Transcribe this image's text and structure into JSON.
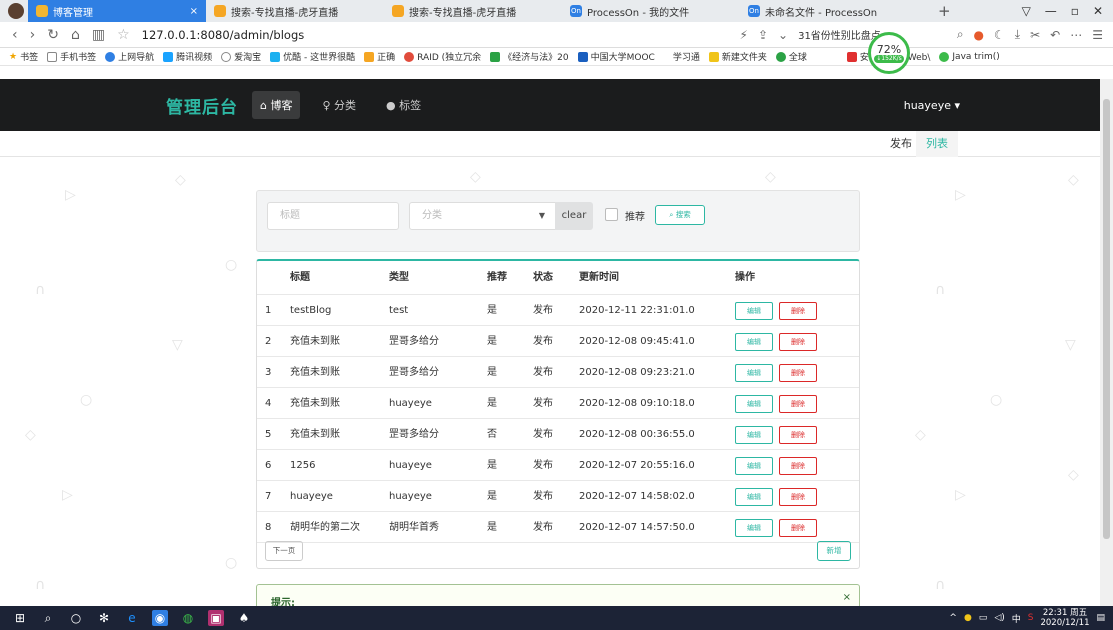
{
  "browser": {
    "tabs": [
      {
        "label": "博客管理",
        "active": true
      },
      {
        "label": "搜索-专找直播-虎牙直播"
      },
      {
        "label": "搜索-专找直播-虎牙直播"
      },
      {
        "label": "ProcessOn - 我的文件"
      },
      {
        "label": "未命名文件 - ProcessOn"
      }
    ],
    "url": "127.0.0.1:8080/admin/blogs",
    "addr_search": "31省份性别比盘点",
    "speed_percent": "72%",
    "speed_rate": "↓152K/s",
    "bookmarks": [
      "书签",
      "手机书签",
      "上网导航",
      "腾讯视频",
      "爱淘宝",
      "优酷 - 这世界很酷",
      "正确",
      "RAID (独立冗余",
      "《经济与法》20",
      "中国大学MOOC",
      "学习通",
      "新建文件夹",
      "全球",
      "安卓上使用 Web\\",
      "Java trim()"
    ]
  },
  "app": {
    "brand": "管理后台",
    "menu": {
      "blog": "博客",
      "category": "分类",
      "tag": "标签"
    },
    "user": "huayeye ▾",
    "subnav": {
      "publish": "发布",
      "list": "列表"
    },
    "search": {
      "title_placeholder": "标题",
      "category_placeholder": "分类",
      "clear": "clear",
      "recommend": "推荐",
      "search_btn": "搜索"
    },
    "table": {
      "headers": [
        "标题",
        "类型",
        "推荐",
        "状态",
        "更新时间",
        "操作"
      ],
      "rows": [
        [
          "1",
          "testBlog",
          "test",
          "是",
          "发布",
          "2020-12-11 22:31:01.0"
        ],
        [
          "2",
          "充值未到账",
          "罡哥多给分",
          "是",
          "发布",
          "2020-12-08 09:45:41.0"
        ],
        [
          "3",
          "充值未到账",
          "罡哥多给分",
          "是",
          "发布",
          "2020-12-08 09:23:21.0"
        ],
        [
          "4",
          "充值未到账",
          "huayeye",
          "是",
          "发布",
          "2020-12-08 09:10:18.0"
        ],
        [
          "5",
          "充值未到账",
          "罡哥多给分",
          "否",
          "发布",
          "2020-12-08 00:36:55.0"
        ],
        [
          "6",
          "1256",
          "huayeye",
          "是",
          "发布",
          "2020-12-07 20:55:16.0"
        ],
        [
          "7",
          "huayeye",
          "huayeye",
          "是",
          "发布",
          "2020-12-07 14:58:02.0"
        ],
        [
          "8",
          "胡明华的第二次",
          "胡明华首秀",
          "是",
          "发布",
          "2020-12-07 14:57:50.0"
        ]
      ],
      "edit": "编辑",
      "delete": "删除",
      "next": "下一页",
      "new": "新增"
    },
    "tip": {
      "title": "提示:",
      "close": "×"
    }
  },
  "taskbar": {
    "tray_lang": "中",
    "time": "22:31 周五",
    "date": "2020/12/11"
  },
  "colors": {
    "accent": "#2db7a3",
    "danger": "#db2828",
    "nav_bg": "#1b1c1d"
  }
}
